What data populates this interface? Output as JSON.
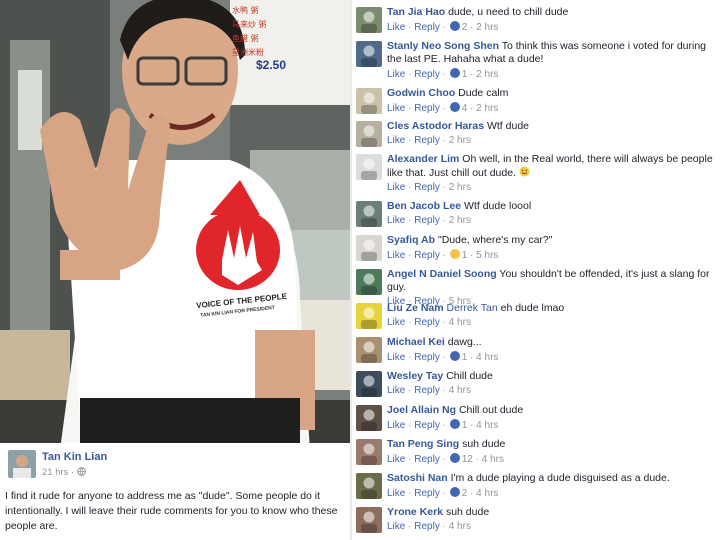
{
  "photo": {
    "shirt_slogan": "VOICE OF THE PEOPLE",
    "shirt_subslogan": "TAN KIN LIAN FOR PRESIDENT",
    "sign_price": "$2.50",
    "sign_rows": [
      "水鸭 粥",
      "马来炒 粥",
      "鱼腊 粥",
      "星洲米粉"
    ]
  },
  "post": {
    "author": "Tan Kin Lian",
    "time": "21 hrs",
    "privacy_icon": "globe-icon",
    "text": "I find it rude for anyone to address me as \"dude\". Some people do it intentionally. I will leave their rude comments for you to know who these people are."
  },
  "action_labels": {
    "like": "Like",
    "reply": "Reply"
  },
  "comments": [
    {
      "author": "Tan Jia Hao",
      "text": "dude, u need to chill dude",
      "reaction": "like",
      "count": "2",
      "time": "2 hrs"
    },
    {
      "author": "Stanly Neo Song Shen",
      "text": "To think this was someone i voted for during the last PE. Hahaha what a dude!",
      "reaction": "like",
      "count": "1",
      "time": "2 hrs"
    },
    {
      "author": "Godwin Choo",
      "text": "Dude calm",
      "reaction": "like",
      "count": "4",
      "time": "2 hrs"
    },
    {
      "author": "Cles Astodor Haras",
      "text": "Wtf dude",
      "reaction": "",
      "count": "",
      "time": "2 hrs"
    },
    {
      "author": "Alexander Lim",
      "text": "Oh well, in the Real world, there will always be people like that. Just chill out dude.",
      "emoji": "smile",
      "reaction": "",
      "count": "",
      "time": "2 hrs"
    },
    {
      "author": "Ben Jacob Lee",
      "text": "Wtf dude loool",
      "reaction": "",
      "count": "",
      "time": "2 hrs"
    },
    {
      "author": "Syafiq Ab",
      "text": "\"Dude, where's my car?\"",
      "reaction": "haha",
      "count": "1",
      "time": "5 hrs"
    },
    {
      "author": "Angel N Daniel Soong",
      "text": "You shouldn't be offended, it's just a slang for guy.",
      "reaction": "",
      "count": "",
      "time": "5 hrs"
    },
    {
      "author": "Liu Ze Nam",
      "tagged": "Derrek Tan",
      "text": "eh dude lmao",
      "reaction": "",
      "count": "",
      "time": "4 hrs"
    },
    {
      "author": "Michael Kei",
      "text": "dawg...",
      "reaction": "like",
      "count": "1",
      "time": "4 hrs"
    },
    {
      "author": "Wesley Tay",
      "text": "Chill dude",
      "reaction": "",
      "count": "",
      "time": "4 hrs"
    },
    {
      "author": "Joel Allain Ng",
      "text": "Chill out dude",
      "reaction": "like",
      "count": "1",
      "time": "4 hrs"
    },
    {
      "author": "Tan Peng Sing",
      "text": "suh dude",
      "reaction": "like",
      "count": "12",
      "time": "4 hrs"
    },
    {
      "author": "Satoshi Nan",
      "text": "I'm a dude playing a dude disguised as a dude.",
      "reaction": "like",
      "count": "2",
      "time": "4 hrs"
    },
    {
      "author": "Yrone Kerk",
      "text": "suh dude",
      "reaction": "",
      "count": "",
      "time": "4 hrs"
    }
  ],
  "colors": {
    "author_link": "#365899",
    "action_link": "#4267b2",
    "meta_gray": "#90949c",
    "text": "#1d2129",
    "shirt_red": "#e0262a"
  }
}
